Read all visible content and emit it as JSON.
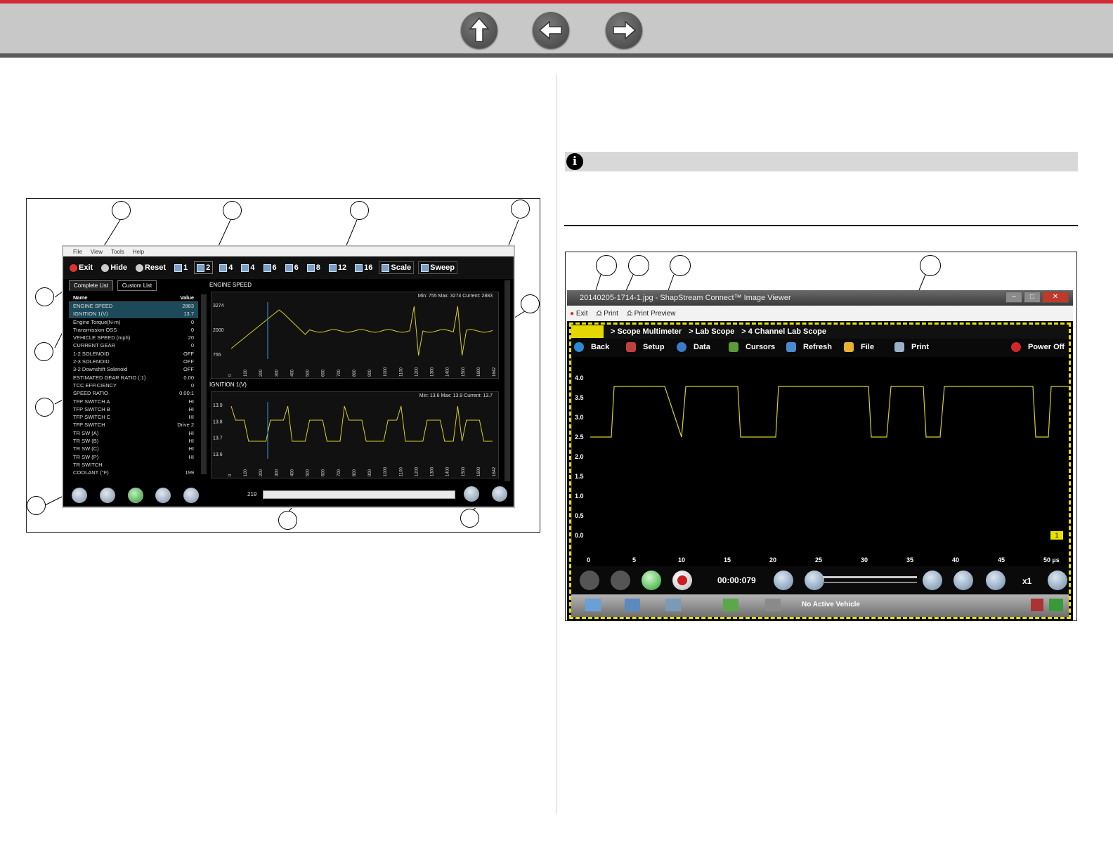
{
  "nav": {
    "up_icon": "up-arrow-icon",
    "back_icon": "left-arrow-icon",
    "forward_icon": "right-arrow-icon",
    "accent": "#d42a35"
  },
  "fig1": {
    "menu": [
      "File",
      "View",
      "Tools",
      "Help"
    ],
    "toolbar": [
      "Exit",
      "Hide",
      "Reset",
      "1",
      "2",
      "4",
      "4",
      "6",
      "6",
      "8",
      "12",
      "16",
      "Scale",
      "Sweep"
    ],
    "tabs": [
      "Complete List",
      "Custom List"
    ],
    "list_headers": {
      "name": "Name",
      "value": "Value"
    },
    "rows": [
      [
        "ENGINE SPEED",
        "2883"
      ],
      [
        "IGNITION 1(V)",
        "13.7"
      ],
      [
        "Engine Torque(N-m)",
        "0"
      ],
      [
        "Transmission OSS",
        "0"
      ],
      [
        "VEHICLE SPEED (mph)",
        "20"
      ],
      [
        "CURRENT GEAR",
        "0"
      ],
      [
        "1-2 SOLENOID",
        "OFF"
      ],
      [
        "2-3 SOLENOID",
        "OFF"
      ],
      [
        "3-2 Downshift Solenoid",
        "OFF"
      ],
      [
        "ESTIMATED GEAR RATIO (:1)",
        "0.00"
      ],
      [
        "TCC EFFICIENCY",
        "0"
      ],
      [
        "SPEED RATIO",
        "0.00:1"
      ],
      [
        "TFP SWITCH A",
        "HI"
      ],
      [
        "TFP SWITCH B",
        "HI"
      ],
      [
        "TFP SWITCH C",
        "HI"
      ],
      [
        "TFP SWITCH",
        "Drive 2"
      ],
      [
        "TR SW (A)",
        "HI"
      ],
      [
        "TR SW (B)",
        "HI"
      ],
      [
        "TR SW (C)",
        "HI"
      ],
      [
        "TR SW (P)",
        "HI"
      ],
      [
        "TR SWITCH",
        ""
      ],
      [
        "COOLANT (°F)",
        "199"
      ]
    ],
    "plot1": {
      "label": "ENGINE SPEED",
      "stats": "Min: 755   Max: 3274   Current: 2883",
      "yticks": [
        "3274",
        "2000",
        "755"
      ]
    },
    "plot2": {
      "label": "IGNITION 1(V)",
      "stats": "Min: 13.6   Max: 13.9   Current: 13.7",
      "yticks": [
        "13.9",
        "13.8",
        "13.7",
        "13.6"
      ]
    },
    "xticks": [
      "0",
      "100",
      "200",
      "300",
      "400",
      "500",
      "600",
      "700",
      "800",
      "900",
      "1000",
      "1100",
      "1200",
      "1300",
      "1400",
      "1500",
      "1600",
      "1642"
    ],
    "frame_counter": "219"
  },
  "fig2": {
    "window_title": "20140205-1714-1.jpg - ShapStream Connect™ Image Viewer",
    "menu": [
      "Exit",
      "Print",
      "Print Preview"
    ],
    "breadcrumb": [
      "> Scope Multimeter",
      "> Lab Scope",
      "> 4 Channel Lab Scope"
    ],
    "toolbar": [
      "Back",
      "Setup",
      "Data",
      "Cursors",
      "Refresh",
      "File",
      "Print"
    ],
    "power": "Power Off",
    "yticks": [
      "4.0",
      "3.5",
      "3.0",
      "2.5",
      "2.0",
      "1.5",
      "1.0",
      "0.5",
      "0.0"
    ],
    "xticks": [
      "0",
      "5",
      "10",
      "15",
      "20",
      "25",
      "30",
      "35",
      "40",
      "45",
      "50 µs"
    ],
    "timer": "00:00:079",
    "zoom": "x1",
    "channel_marker": "1",
    "status": "No Active Vehicle"
  }
}
